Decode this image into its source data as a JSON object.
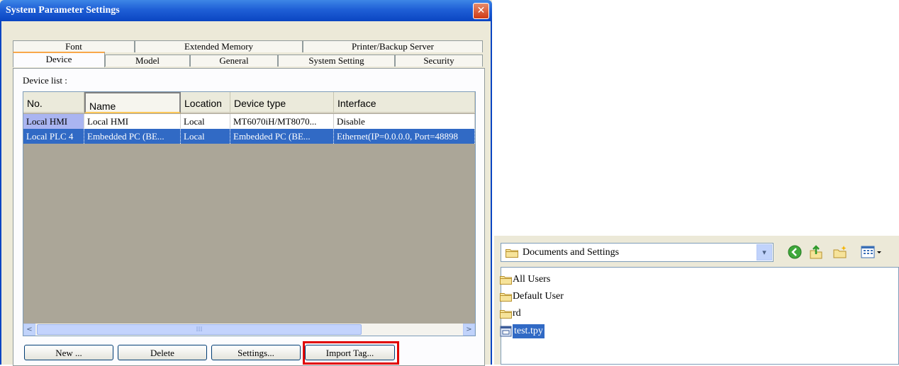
{
  "dialog": {
    "title": "System Parameter Settings",
    "close_symbol": "✕",
    "tabs_row1": [
      "Font",
      "Extended Memory",
      "Printer/Backup Server"
    ],
    "tabs_row2": [
      "Device",
      "Model",
      "General",
      "System Setting",
      "Security"
    ],
    "active_tab": "Device",
    "device_list_label": "Device list :",
    "columns": [
      "No.",
      "Name",
      "Location",
      "Device type",
      "Interface"
    ],
    "rows": [
      [
        "Local HMI",
        "Local HMI",
        "Local",
        "MT6070iH/MT8070...",
        "Disable"
      ],
      [
        "Local PLC 4",
        "Embedded PC (BE...",
        "Local",
        "Embedded PC (BE...",
        "Ethernet(IP=0.0.0.0, Port=48898"
      ]
    ],
    "scroll_left": "<",
    "scroll_right": ">",
    "scroll_grip": "III",
    "buttons": {
      "new": "New ...",
      "delete": "Delete",
      "settings": "Settings...",
      "import_tag": "Import Tag..."
    },
    "highlight_color": "#e00000"
  },
  "browser": {
    "address": "Documents and Settings",
    "dropdown_symbol": "▾",
    "toolbar_icons": [
      "back-icon",
      "up-folder-icon",
      "new-folder-icon",
      "views-menu-icon"
    ],
    "items": [
      {
        "name": "All Users",
        "icon": "folder-icon"
      },
      {
        "name": "Default User",
        "icon": "folder-icon"
      },
      {
        "name": "rd",
        "icon": "folder-icon"
      },
      {
        "name": "test.tpy",
        "icon": "file-icon",
        "selected": true
      }
    ]
  }
}
